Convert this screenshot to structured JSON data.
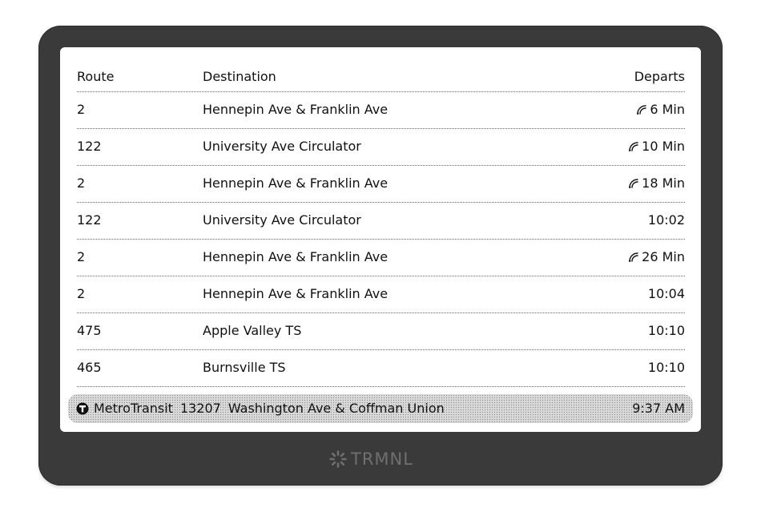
{
  "table": {
    "headers": {
      "route": "Route",
      "destination": "Destination",
      "departs": "Departs"
    },
    "rows": [
      {
        "route": "2",
        "destination": "Hennepin Ave & Franklin Ave",
        "departs": "6 Min",
        "realtime": true
      },
      {
        "route": "122",
        "destination": "University Ave Circulator",
        "departs": "10 Min",
        "realtime": true
      },
      {
        "route": "2",
        "destination": "Hennepin Ave & Franklin Ave",
        "departs": "18 Min",
        "realtime": true
      },
      {
        "route": "122",
        "destination": "University Ave Circulator",
        "departs": "10:02",
        "realtime": false
      },
      {
        "route": "2",
        "destination": "Hennepin Ave & Franklin Ave",
        "departs": "26 Min",
        "realtime": true
      },
      {
        "route": "2",
        "destination": "Hennepin Ave & Franklin Ave",
        "departs": "10:04",
        "realtime": false
      },
      {
        "route": "475",
        "destination": "Apple Valley TS",
        "departs": "10:10",
        "realtime": false
      },
      {
        "route": "465",
        "destination": "Burnsville TS",
        "departs": "10:10",
        "realtime": false
      }
    ]
  },
  "footer": {
    "agency": "MetroTransit",
    "stop_id": "13207",
    "stop_name": "Washington Ave & Coffman Union",
    "time": "9:37 AM",
    "icon": "metro-transit-logo-icon"
  },
  "device": {
    "brand": "TRMNL",
    "brand_icon": "trmnl-logo-icon"
  },
  "colors": {
    "bezel": "#3a3a3a",
    "screen": "#ffffff",
    "text": "#111111",
    "brand": "#6f6f6f"
  }
}
